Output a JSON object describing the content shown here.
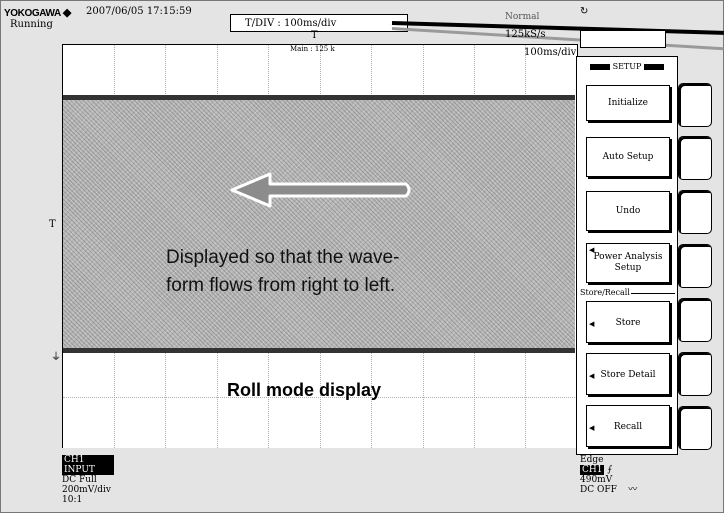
{
  "header": {
    "brand": "YOKOGAWA",
    "brand_mark": "◆",
    "datetime": "2007/06/05 17:15:59",
    "status": "Running",
    "tdiv": "T/DIV  :  100ms/div",
    "acq_mode_faint": "Normal",
    "sample_rate": "125kS/s"
  },
  "screen": {
    "main_label": "Main : 125 k",
    "trigger_pos_mark": "T",
    "time_per_div": "100ms/div",
    "trigger_level_mark": "T",
    "ground_mark": "⏚"
  },
  "annotations": {
    "flow_line1": "Displayed so that the wave-",
    "flow_line2": "form flows from right to left.",
    "roll_mode": "Roll mode display"
  },
  "channel": {
    "title": "CH1 INPUT",
    "coupling": "DC Full",
    "scale": "200mV/div",
    "probe": "10:1"
  },
  "trigger": {
    "type": "Edge",
    "source": "CH1",
    "slope_symbol": "⨍",
    "level": "490mV",
    "hf_reject": "DC OFF",
    "hf_symbol": "〰"
  },
  "setup_menu": {
    "title": "SETUP",
    "group_store_recall": "Store/Recall",
    "items": [
      {
        "label": "Initialize"
      },
      {
        "label": "Auto Setup"
      },
      {
        "label": "Undo"
      },
      {
        "label": "Power Analysis Setup"
      },
      {
        "label": "Store"
      },
      {
        "label": "Store Detail"
      },
      {
        "label": "Recall"
      }
    ]
  },
  "icons": {
    "arrow": "left-arrow-icon",
    "knob": "rotary-knob-icon"
  },
  "colors": {
    "waveform_fill": "#b8b8b8",
    "waveform_edge": "#333333",
    "arrow_fill": "#8c8c8c"
  }
}
